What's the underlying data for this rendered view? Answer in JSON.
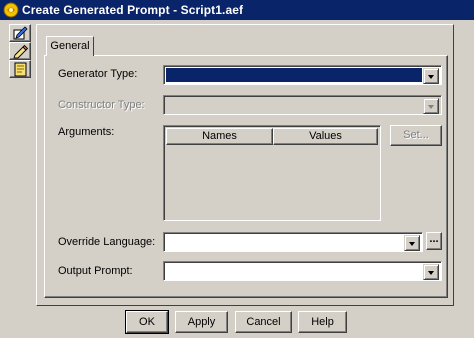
{
  "window": {
    "title": "Create Generated Prompt - Script1.aef",
    "title_bar_color": "#0a246a",
    "face_color": "#d4d0c8"
  },
  "side_tabs": [
    {
      "icon": "document-pencil-icon"
    },
    {
      "icon": "pencil-icon"
    },
    {
      "icon": "script-icon"
    }
  ],
  "tabs": {
    "general_label": "General"
  },
  "form": {
    "generator_type_label": "Generator Type:",
    "generator_type_value": "",
    "constructor_type_label": "Constructor Type:",
    "constructor_type_value": "",
    "arguments_label": "Arguments:",
    "arguments_columns": [
      "Names",
      "Values"
    ],
    "set_button_label": "Set...",
    "override_language_label": "Override Language:",
    "override_language_value": "",
    "ellipsis_button_label": "...",
    "output_prompt_label": "Output Prompt:",
    "output_prompt_value": ""
  },
  "buttons": {
    "ok": "OK",
    "apply": "Apply",
    "cancel": "Cancel",
    "help": "Help"
  }
}
